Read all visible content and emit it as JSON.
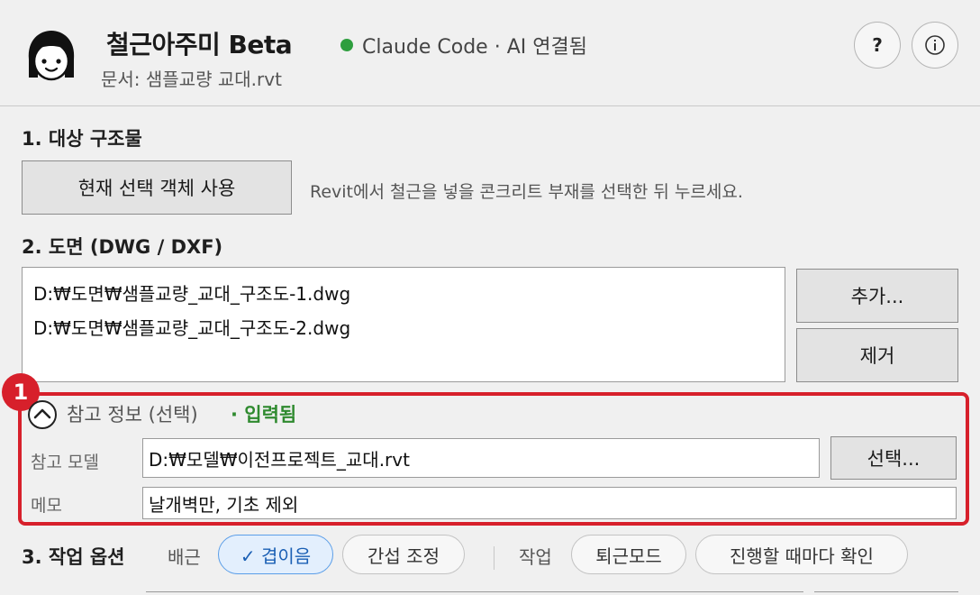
{
  "header": {
    "app_title": "철근아주미 Beta",
    "status_text": "Claude Code · AI 연결됨",
    "status_color": "#2e9e3e",
    "document": "문서: 샘플교량 교대.rvt",
    "help_label": "?",
    "info_label": "ⓘ"
  },
  "section1": {
    "title": "1. 대상 구조물",
    "use_selection_button": "현재 선택 객체 사용",
    "hint": "Revit에서 철근을 넣을 콘크리트 부재를 선택한 뒤 누르세요."
  },
  "section2": {
    "title": "2. 도면 (DWG / DXF)",
    "files": [
      "D:₩도면₩샘플교량_교대_구조도-1.dwg",
      "D:₩도면₩샘플교량_교대_구조도-2.dwg"
    ],
    "add_button": "추가...",
    "remove_button": "제거"
  },
  "reference": {
    "badge": "1",
    "header": "참고 정보 (선택)",
    "entered": "· 입력됨",
    "entered_color": "#2f8a2f",
    "highlight_color": "#d7202b",
    "model_label": "참고 모델",
    "model_value": "D:₩모델₩이전프로젝트_교대.rvt",
    "select_button": "선택...",
    "memo_label": "메모",
    "memo_value": "날개벽만, 기초 제외"
  },
  "section3": {
    "title": "3. 작업 옵션",
    "rebar_label": "배근",
    "rebar_options": [
      "✓ 겹이음",
      "간섭 조정"
    ],
    "work_label": "작업",
    "work_options": [
      "퇴근모드",
      "진행할 때마다 확인"
    ],
    "active_color": "#5b9ee8"
  }
}
